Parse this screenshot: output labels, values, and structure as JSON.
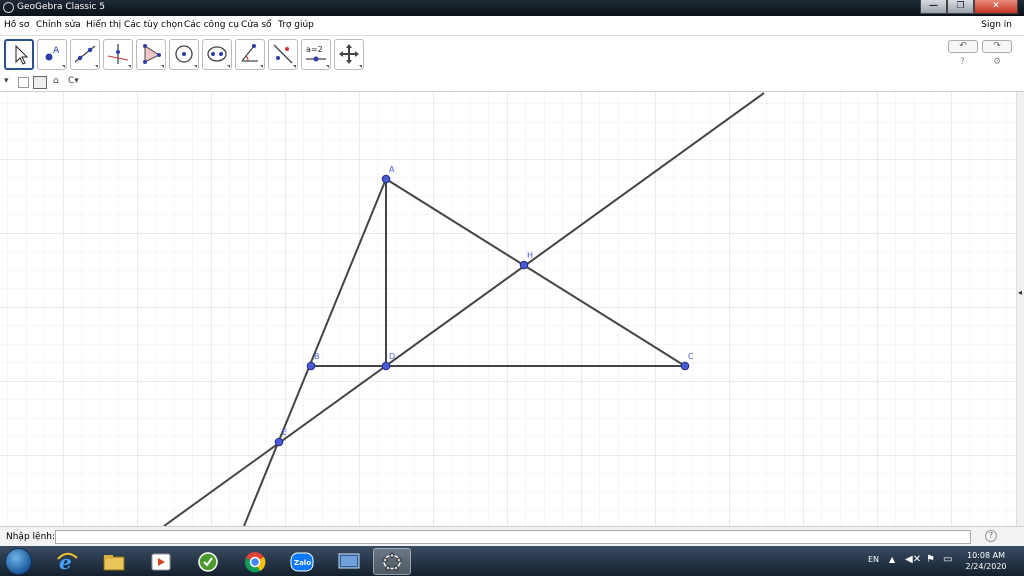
{
  "window": {
    "title": "GeoGebra Classic 5",
    "buttons": {
      "minimize": "—",
      "maximize": "❐",
      "close": "✕"
    }
  },
  "menu": {
    "items": [
      "Hồ sơ",
      "Chỉnh sửa",
      "Hiển thị",
      "Các tùy chọn",
      "Các công cụ",
      "Cửa sổ",
      "Trợ giúp"
    ],
    "sign_in": "Sign in"
  },
  "toolbar": {
    "tools": [
      {
        "name": "move-tool-icon"
      },
      {
        "name": "point-tool-icon"
      },
      {
        "name": "line-tool-icon"
      },
      {
        "name": "perpendicular-line-tool-icon"
      },
      {
        "name": "polygon-tool-icon"
      },
      {
        "name": "circle-tool-icon"
      },
      {
        "name": "conic-tool-icon"
      },
      {
        "name": "angle-tool-icon"
      },
      {
        "name": "reflect-tool-icon"
      },
      {
        "name": "slider-tool-icon",
        "label": "a=2"
      },
      {
        "name": "move-graphics-view-tool-icon"
      }
    ],
    "undo": "↶",
    "redo": "↷"
  },
  "stylebar": {
    "menu_arrow": "▾",
    "home": "⌂"
  },
  "construction": {
    "points": [
      {
        "label": "A"
      },
      {
        "label": "B"
      },
      {
        "label": "D"
      },
      {
        "label": "C"
      },
      {
        "label": "H"
      },
      {
        "label": "E"
      }
    ]
  },
  "input_bar": {
    "label": "Nhập lệnh:",
    "value": "",
    "help": "?"
  },
  "taskbar": {
    "language": "EN",
    "time": "10:08 AM",
    "date": "2/24/2020",
    "apps": [
      "ie-icon",
      "file-explorer-icon",
      "media-player-icon",
      "cc-cleaner-icon",
      "chrome-icon",
      "zalo-icon",
      "screen-icon",
      "geogebra-icon"
    ]
  },
  "colors": {
    "titlebar": "#0b1118",
    "tool_active_border": "#2a4f8c",
    "point_fill": "#4a5bd6",
    "line": "#444444",
    "grid": "#e5e5e5"
  }
}
